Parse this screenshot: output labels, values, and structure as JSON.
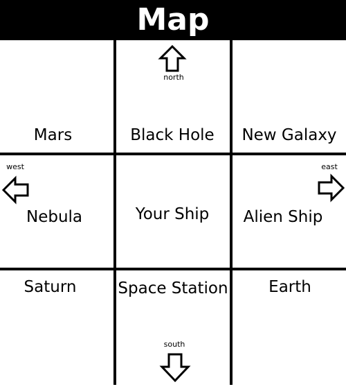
{
  "title": "Map",
  "directions": {
    "north": "north",
    "south": "south",
    "west": "west",
    "east": "east"
  },
  "locations": {
    "top_left": "Mars",
    "top_center": "Black Hole",
    "top_right": "New Galaxy",
    "middle_left": "Nebula",
    "middle_center": "Your Ship",
    "middle_right": "Alien Ship",
    "bottom_left": "Saturn",
    "bottom_center": "Space Station",
    "bottom_right": "Earth"
  },
  "icons": {
    "north": "arrow-up-icon",
    "south": "arrow-down-icon",
    "west": "arrow-left-icon",
    "east": "arrow-right-icon"
  }
}
